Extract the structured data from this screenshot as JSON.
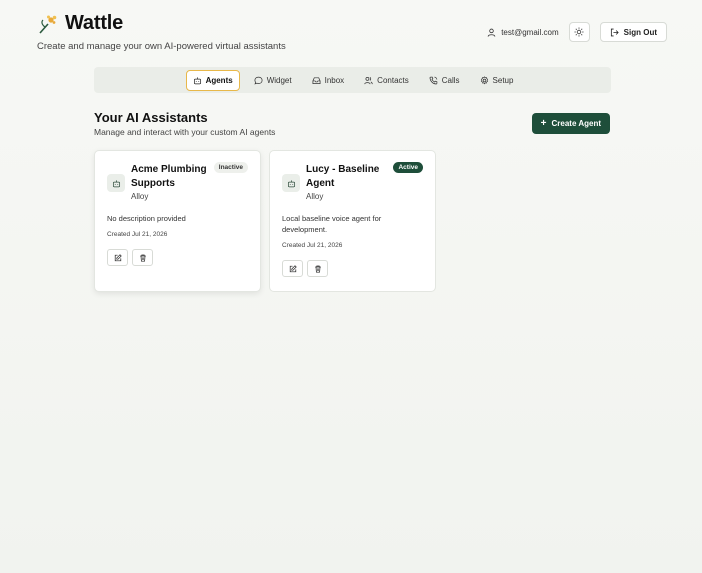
{
  "header": {
    "brand": "Wattle",
    "tagline": "Create and manage your own AI-powered virtual assistants"
  },
  "user": {
    "email": "test@gmail.com",
    "signout_label": "Sign Out"
  },
  "nav": {
    "items": [
      {
        "label": "Agents",
        "icon": "bot-icon",
        "active": true
      },
      {
        "label": "Widget",
        "icon": "chat-bubble-icon",
        "active": false
      },
      {
        "label": "Inbox",
        "icon": "inbox-icon",
        "active": false
      },
      {
        "label": "Contacts",
        "icon": "users-icon",
        "active": false
      },
      {
        "label": "Calls",
        "icon": "phone-icon",
        "active": false
      },
      {
        "label": "Setup",
        "icon": "gear-icon",
        "active": false
      }
    ]
  },
  "main": {
    "title": "Your AI Assistants",
    "subtitle": "Manage and interact with your custom AI agents",
    "create_label": "Create Agent"
  },
  "agents": [
    {
      "name": "Acme Plumbing Supports",
      "voice": "Alloy",
      "status": "Inactive",
      "description": "No description provided",
      "created": "Created Jul 21, 2026"
    },
    {
      "name": "Lucy - Baseline Agent",
      "voice": "Alloy",
      "status": "Active",
      "description": "Local baseline voice agent for development.",
      "created": "Created Jul 21, 2026"
    }
  ],
  "colors": {
    "primary": "#1e4e3a",
    "active_tab_border": "#e8b84a",
    "logo_accent": "#e8a93a"
  }
}
